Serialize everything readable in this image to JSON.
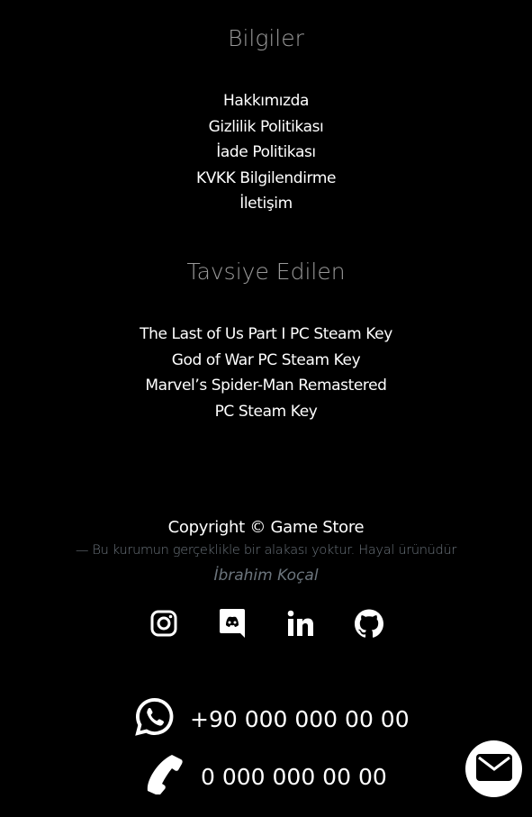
{
  "info": {
    "title": "Bilgiler",
    "links": [
      "Hakkımızda",
      "Gizlilik Politikası",
      "İade Politikası",
      "KVKK Bilgilendirme",
      "İletişim"
    ]
  },
  "recommended": {
    "title": "Tavsiye Edilen",
    "links": [
      "The Last of Us Part I PC Steam Key",
      "God of War PC Steam Key",
      "Marvel’s Spider-Man Remastered",
      "PC Steam Key"
    ]
  },
  "footer": {
    "copyright": "Copyright © Game Store",
    "disclaimer": "—  Bu kurumun gerçeklikle bir alakası yoktur. Hayal ürünüdür",
    "author": "İbrahim Koçal"
  },
  "social": [
    "instagram-icon",
    "discord-icon",
    "linkedin-icon",
    "github-icon"
  ],
  "contact": {
    "whatsapp": "+90 000 000 00 00",
    "phone": "0 000 000 00 00"
  }
}
